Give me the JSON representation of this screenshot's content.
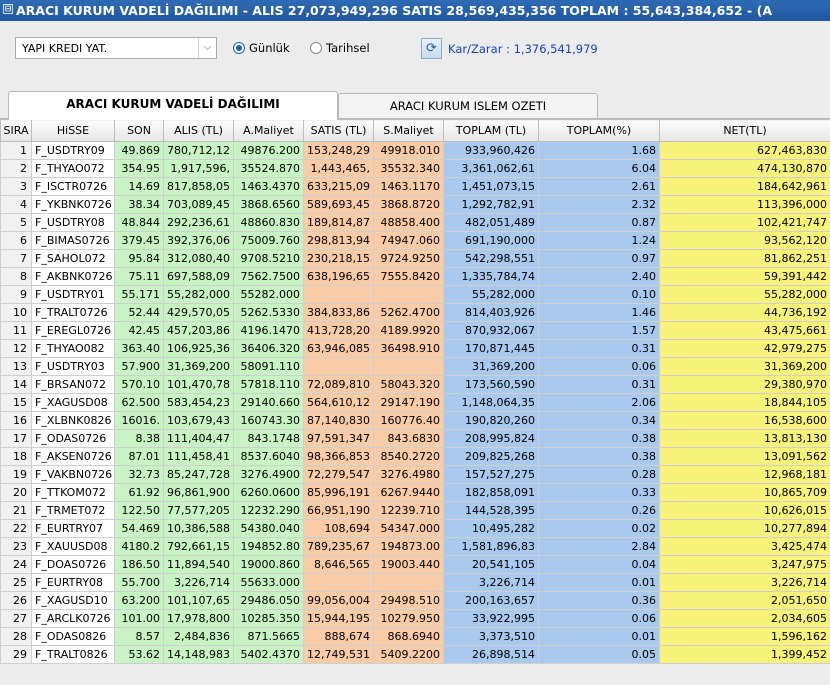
{
  "window": {
    "title": "ARACI KURUM VADELİ DAĞILIMI - ALIS 27,073,949,296  SATIS 28,569,435,356  TOPLAM : 55,643,384,652 - (A"
  },
  "toolbar": {
    "broker_value": "YAPI KREDI YAT.",
    "radio_gunluk": "Günlük",
    "radio_tarihsel": "Tarihsel",
    "radio_selected": "Günlük",
    "karzarar": "Kar/Zarar : 1,376,541,979"
  },
  "tabs": [
    {
      "label": "ARACI KURUM VADELİ DAĞILIMI",
      "active": true
    },
    {
      "label": "ARACI KURUM ISLEM OZETI",
      "active": false
    }
  ],
  "colors": {
    "green": "#c8f3c3",
    "orange": "#f9cba6",
    "blue": "#a9c9ee",
    "yellow": "#f6f27a"
  },
  "table": {
    "columns": [
      "SIRA",
      "HiSSE",
      "SON",
      "ALIS (TL)",
      "A.Maliyet",
      "SATIS (TL)",
      "S.Maliyet",
      "TOPLAM (TL)",
      "TOPLAM(%)",
      "NET(TL)"
    ],
    "rows": [
      [
        "1",
        "F_USDTRY09",
        "49.869",
        "780,712,12",
        "49876.200",
        "153,248,29",
        "49918.010",
        "933,960,426",
        "1.68",
        "627,463,830"
      ],
      [
        "2",
        "F_THYAO072",
        "354.95",
        "1,917,596,",
        "35524.870",
        "1,443,465,",
        "35532.340",
        "3,361,062,61",
        "6.04",
        "474,130,870"
      ],
      [
        "3",
        "F_ISCTR0726",
        "14.69",
        "817,858,05",
        "1463.4370",
        "633,215,09",
        "1463.1170",
        "1,451,073,15",
        "2.61",
        "184,642,961"
      ],
      [
        "4",
        "F_YKBNK0726",
        "38.34",
        "703,089,45",
        "3868.6560",
        "589,693,45",
        "3868.8720",
        "1,292,782,91",
        "2.32",
        "113,396,000"
      ],
      [
        "5",
        "F_USDTRY08",
        "48.844",
        "292,236,61",
        "48860.830",
        "189,814,87",
        "48858.400",
        "482,051,489",
        "0.87",
        "102,421,747"
      ],
      [
        "6",
        "F_BIMAS0726",
        "379.45",
        "392,376,06",
        "75009.760",
        "298,813,94",
        "74947.060",
        "691,190,000",
        "1.24",
        "93,562,120"
      ],
      [
        "7",
        "F_SAHOL072",
        "95.84",
        "312,080,40",
        "9708.5210",
        "230,218,15",
        "9724.9250",
        "542,298,551",
        "0.97",
        "81,862,251"
      ],
      [
        "8",
        "F_AKBNK0726",
        "75.11",
        "697,588,09",
        "7562.7500",
        "638,196,65",
        "7555.8420",
        "1,335,784,74",
        "2.40",
        "59,391,442"
      ],
      [
        "9",
        "F_USDTRY01",
        "55.171",
        "55,282,000",
        "55282.000",
        "",
        "",
        "55,282,000",
        "0.10",
        "55,282,000"
      ],
      [
        "10",
        "F_TRALT0726",
        "52.44",
        "429,570,05",
        "5262.5330",
        "384,833,86",
        "5262.4700",
        "814,403,926",
        "1.46",
        "44,736,192"
      ],
      [
        "11",
        "F_EREGL0726",
        "42.45",
        "457,203,86",
        "4196.1470",
        "413,728,20",
        "4189.9920",
        "870,932,067",
        "1.57",
        "43,475,661"
      ],
      [
        "12",
        "F_THYAO082",
        "363.40",
        "106,925,36",
        "36406.320",
        "63,946,085",
        "36498.910",
        "170,871,445",
        "0.31",
        "42,979,275"
      ],
      [
        "13",
        "F_USDTRY03",
        "57.900",
        "31,369,200",
        "58091.110",
        "",
        "",
        "31,369,200",
        "0.06",
        "31,369,200"
      ],
      [
        "14",
        "F_BRSAN072",
        "570.10",
        "101,470,78",
        "57818.110",
        "72,089,810",
        "58043.320",
        "173,560,590",
        "0.31",
        "29,380,970"
      ],
      [
        "15",
        "F_XAGUSD08",
        "62.500",
        "583,454,23",
        "29140.660",
        "564,610,12",
        "29147.190",
        "1,148,064,35",
        "2.06",
        "18,844,105"
      ],
      [
        "16",
        "F_XLBNK0826",
        "16016.",
        "103,679,43",
        "160743.30",
        "87,140,830",
        "160776.40",
        "190,820,260",
        "0.34",
        "16,538,600"
      ],
      [
        "17",
        "F_ODAS0726",
        "8.38",
        "111,404,47",
        "843.1748",
        "97,591,347",
        "843.6830",
        "208,995,824",
        "0.38",
        "13,813,130"
      ],
      [
        "18",
        "F_AKSEN0726",
        "87.01",
        "111,458,41",
        "8537.6040",
        "98,366,853",
        "8540.2720",
        "209,825,268",
        "0.38",
        "13,091,562"
      ],
      [
        "19",
        "F_VAKBN0726",
        "32.73",
        "85,247,728",
        "3276.4900",
        "72,279,547",
        "3276.4980",
        "157,527,275",
        "0.28",
        "12,968,181"
      ],
      [
        "20",
        "F_TTKOM072",
        "61.92",
        "96,861,900",
        "6260.0600",
        "85,996,191",
        "6267.9440",
        "182,858,091",
        "0.33",
        "10,865,709"
      ],
      [
        "21",
        "F_TRMET072",
        "122.50",
        "77,577,205",
        "12232.290",
        "66,951,190",
        "12239.710",
        "144,528,395",
        "0.26",
        "10,626,015"
      ],
      [
        "22",
        "F_EURTRY07",
        "54.469",
        "10,386,588",
        "54380.040",
        "108,694",
        "54347.000",
        "10,495,282",
        "0.02",
        "10,277,894"
      ],
      [
        "23",
        "F_XAUUSD08",
        "4180.2",
        "792,661,15",
        "194852.80",
        "789,235,67",
        "194873.00",
        "1,581,896,83",
        "2.84",
        "3,425,474"
      ],
      [
        "24",
        "F_DOAS0726",
        "186.50",
        "11,894,540",
        "19000.860",
        "8,646,565",
        "19003.440",
        "20,541,105",
        "0.04",
        "3,247,975"
      ],
      [
        "25",
        "F_EURTRY08",
        "55.700",
        "3,226,714",
        "55633.000",
        "",
        "",
        "3,226,714",
        "0.01",
        "3,226,714"
      ],
      [
        "26",
        "F_XAGUSD10",
        "63.200",
        "101,107,65",
        "29486.050",
        "99,056,004",
        "29498.510",
        "200,163,657",
        "0.36",
        "2,051,650"
      ],
      [
        "27",
        "F_ARCLK0726",
        "101.00",
        "17,978,800",
        "10285.350",
        "15,944,195",
        "10279.950",
        "33,922,995",
        "0.06",
        "2,034,605"
      ],
      [
        "28",
        "F_ODAS0826",
        "8.57",
        "2,484,836",
        "871.5665",
        "888,674",
        "868.6940",
        "3,373,510",
        "0.01",
        "1,596,162"
      ],
      [
        "29",
        "F_TRALT0826",
        "53.62",
        "14,148,983",
        "5402.4370",
        "12,749,531",
        "5409.2200",
        "26,898,514",
        "0.05",
        "1,399,452"
      ]
    ]
  }
}
